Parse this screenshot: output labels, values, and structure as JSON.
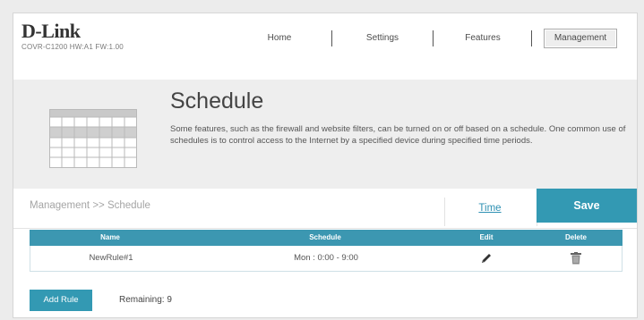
{
  "logo": {
    "brand": "D-Link",
    "device_info": "COVR-C1200 HW:A1 FW:1.00"
  },
  "nav": {
    "items": [
      "Home",
      "Settings",
      "Features",
      "Management"
    ],
    "active": "Management"
  },
  "banner": {
    "title": "Schedule",
    "description": "Some features, such as the firewall and website filters, can be turned on or off based on a schedule. One common use of schedules is to control access to the Internet by a specified device during specified time periods."
  },
  "breadcrumb": "Management >> Schedule",
  "actions": {
    "time_label": "Time",
    "save_label": "Save"
  },
  "table": {
    "headers": {
      "name": "Name",
      "schedule": "Schedule",
      "edit": "Edit",
      "delete": "Delete"
    },
    "rows": [
      {
        "name": "NewRule#1",
        "schedule": "Mon : 0:00 - 9:00"
      }
    ]
  },
  "footer": {
    "add_rule_label": "Add Rule",
    "remaining_text": "Remaining: 9"
  },
  "colors": {
    "accent": "#3399b3",
    "header_bar": "#3c97b1",
    "banner_bg": "#eeeeee"
  }
}
